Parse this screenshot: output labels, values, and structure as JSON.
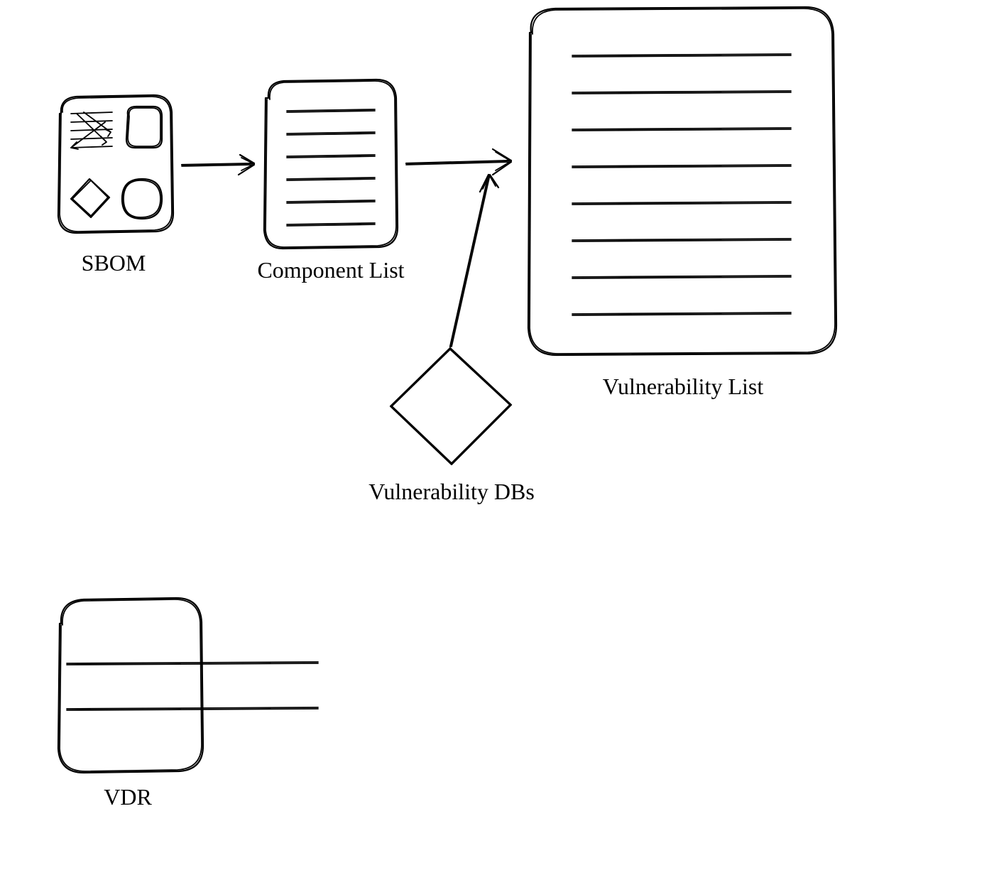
{
  "nodes": {
    "sbom": {
      "label": "SBOM"
    },
    "component_list": {
      "label": "Component List"
    },
    "vulnerability_list": {
      "label": "Vulnerability List"
    },
    "vulnerability_dbs": {
      "label": "Vulnerability DBs"
    },
    "vdr": {
      "label": "VDR"
    }
  },
  "edges": [
    {
      "from": "sbom",
      "to": "component_list"
    },
    {
      "from": "component_list",
      "to": "vulnerability_list"
    },
    {
      "from": "vulnerability_dbs",
      "to": "vulnerability_list"
    }
  ]
}
